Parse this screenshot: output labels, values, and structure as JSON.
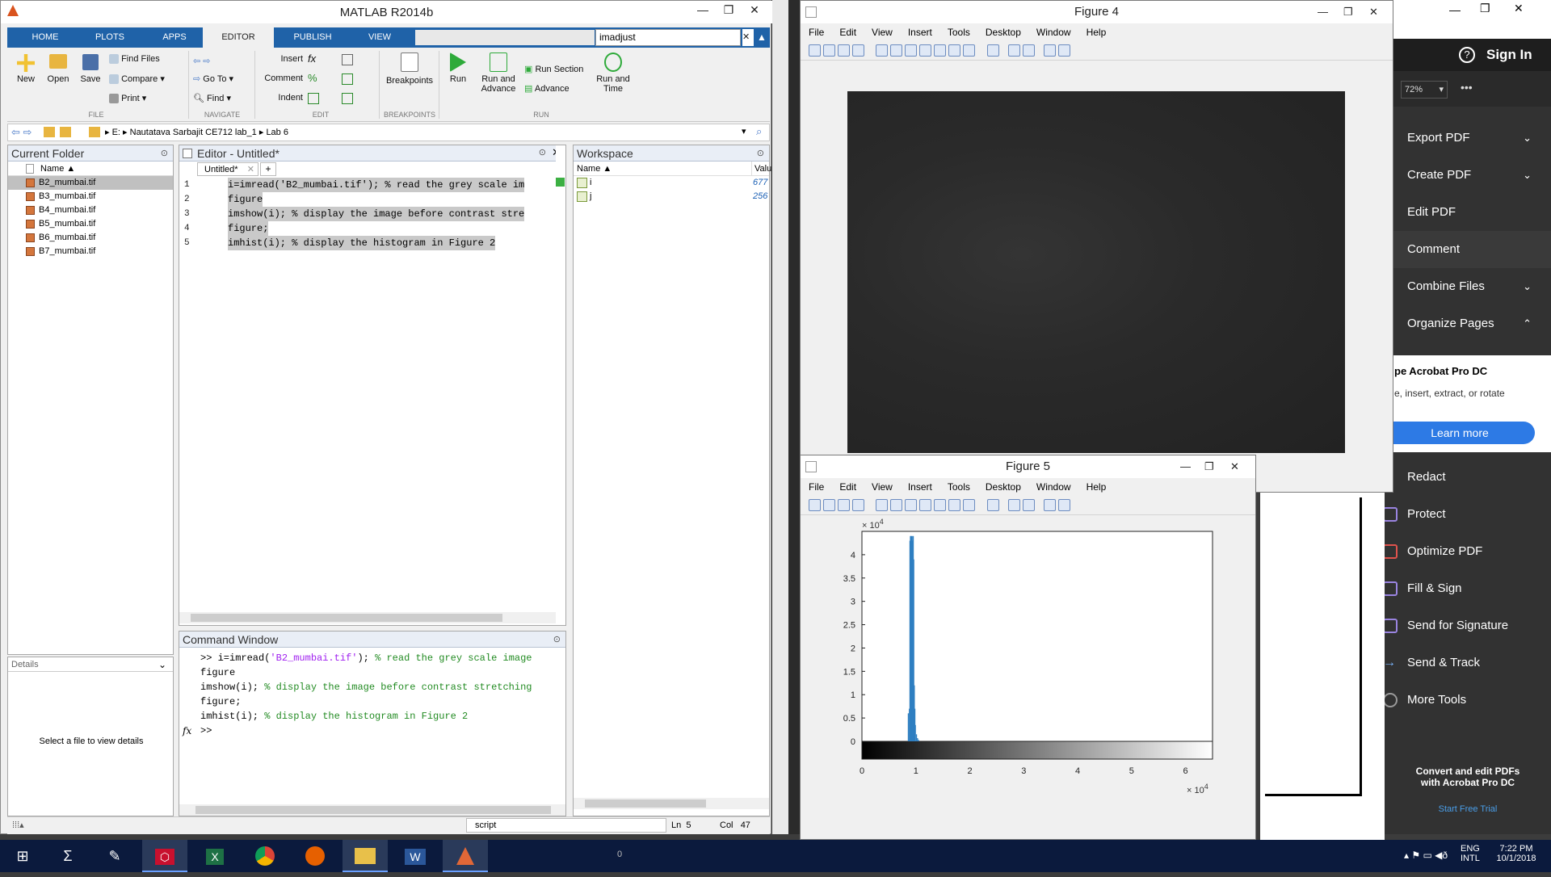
{
  "matlab": {
    "title": "MATLAB R2014b",
    "tabs": [
      "HOME",
      "PLOTS",
      "APPS",
      "EDITOR",
      "PUBLISH",
      "VIEW"
    ],
    "search_value": "imadjust",
    "ribbon": {
      "new": "New",
      "open": "Open",
      "save": "Save",
      "find_files": "Find Files",
      "compare": "Compare",
      "print": "Print",
      "go_to": "Go To",
      "find": "Find",
      "insert": "Insert",
      "comment": "Comment",
      "indent": "Indent",
      "breakpoints": "Breakpoints",
      "run": "Run",
      "run_and_advance_1": "Run and",
      "run_and_advance_2": "Advance",
      "run_section": "Run Section",
      "advance": "Advance",
      "run_and_time_1": "Run and",
      "run_and_time_2": "Time"
    },
    "groups": {
      "file": "FILE",
      "navigate": "NAVIGATE",
      "edit": "EDIT",
      "breakpoints": "BREAKPOINTS",
      "run": "RUN"
    },
    "path": [
      "E:",
      "Nautatava Sarbajit CE712 lab_1",
      "Lab 6"
    ],
    "current_folder": {
      "title": "Current Folder",
      "col_name": "Name",
      "files": [
        "B2_mumbai.tif",
        "B3_mumbai.tif",
        "B4_mumbai.tif",
        "B5_mumbai.tif",
        "B6_mumbai.tif",
        "B7_mumbai.tif"
      ],
      "details_title": "Details",
      "details_text": "Select a file to view details"
    },
    "editor": {
      "title": "Editor - Untitled*",
      "tab": "Untitled*",
      "tab_add": "+",
      "lines": [
        {
          "n": "1",
          "code": "i=imread('B2_mumbai.tif'); % read the grey scale im"
        },
        {
          "n": "2",
          "code": "figure"
        },
        {
          "n": "3",
          "code": "imshow(i); % display the image before contrast stre"
        },
        {
          "n": "4",
          "code": "figure;"
        },
        {
          "n": "5",
          "code": "imhist(i); % display the histogram in Figure 2"
        }
      ]
    },
    "workspace": {
      "title": "Workspace",
      "col_name": "Name",
      "col_value": "Valu",
      "vars": [
        {
          "name": "i",
          "value": "677"
        },
        {
          "name": "j",
          "value": "256"
        }
      ]
    },
    "command_window": {
      "title": "Command Window",
      "l1a": ">> i=imread(",
      "l1b": "'B2_mumbai.tif'",
      "l1c": "); ",
      "l1d": "% read the grey scale image",
      "l2": "figure",
      "l3a": "imshow(i); ",
      "l3b": "% display the image before contrast stretching",
      "l4": "figure;",
      "l5a": "imhist(i); ",
      "l5b": "% display the histogram in Figure 2",
      "prompt": ">>",
      "fx": "fx"
    },
    "status": {
      "script": "script",
      "ln_label": "Ln",
      "ln": "5",
      "col_label": "Col",
      "col": "47"
    }
  },
  "figure4": {
    "title": "Figure 4",
    "menu": [
      "File",
      "Edit",
      "View",
      "Insert",
      "Tools",
      "Desktop",
      "Window",
      "Help"
    ]
  },
  "figure5": {
    "title": "Figure 5",
    "menu": [
      "File",
      "Edit",
      "View",
      "Insert",
      "Tools",
      "Desktop",
      "Window",
      "Help"
    ],
    "exp_y": "× 10",
    "exp_y_pow": "4",
    "exp_x": "× 10",
    "exp_x_pow": "4"
  },
  "chart_data": {
    "type": "bar",
    "title": "",
    "xlabel": "",
    "ylabel": "",
    "xlim": [
      0,
      6.5
    ],
    "ylim": [
      0,
      4.5
    ],
    "x_ticks": [
      "0",
      "1",
      "2",
      "3",
      "4",
      "5",
      "6"
    ],
    "y_ticks": [
      "0",
      "0.5",
      "1",
      "1.5",
      "2",
      "2.5",
      "3",
      "3.5",
      "4"
    ],
    "x": [
      0.85,
      0.87,
      0.88,
      0.89,
      0.9,
      0.91,
      0.92,
      0.93,
      0.94,
      0.95,
      0.96,
      0.97,
      0.98,
      1.0,
      1.02,
      1.04
    ],
    "values": [
      0.6,
      0.7,
      4.3,
      4.4,
      4.4,
      4.35,
      4.4,
      4.3,
      4.4,
      3.9,
      1.2,
      0.7,
      0.35,
      0.15,
      0.07,
      0.03
    ],
    "x_exponent": "10^4",
    "y_exponent": "10^4",
    "colorbar": "grayscale"
  },
  "acrobat": {
    "sign_in": "Sign In",
    "zoom": "72%",
    "more": "•••",
    "tools": [
      {
        "label": "Export PDF",
        "chev": "⌄"
      },
      {
        "label": "Create PDF",
        "chev": "⌄"
      },
      {
        "label": "Edit PDF",
        "chev": ""
      },
      {
        "label": "Comment",
        "chev": ""
      },
      {
        "label": "Combine Files",
        "chev": "⌄"
      },
      {
        "label": "Organize Pages",
        "chev": "⌃"
      }
    ],
    "promo_title": "pe Acrobat Pro DC",
    "promo_text": "e, insert, extract, or rotate",
    "learn_more": "Learn more",
    "tools2": [
      {
        "label": "Redact",
        "icon": "redact-icon"
      },
      {
        "label": "Protect",
        "icon": "shield-icon"
      },
      {
        "label": "Optimize PDF",
        "icon": "optimize-icon"
      },
      {
        "label": "Fill & Sign",
        "icon": "pen-icon"
      },
      {
        "label": "Send for Signature",
        "icon": "signature-icon"
      },
      {
        "label": "Send & Track",
        "icon": "arrow-right-icon"
      },
      {
        "label": "More Tools",
        "icon": "plus-circle-icon"
      }
    ],
    "convert_1": "Convert and edit PDFs",
    "convert_2": "with Acrobat Pro DC",
    "trial": "Start Free Trial"
  },
  "taskbar": {
    "lang_1": "ENG",
    "lang_2": "INTL",
    "time": "7:22 PM",
    "date": "10/1/2018",
    "bg_zero": "0"
  }
}
